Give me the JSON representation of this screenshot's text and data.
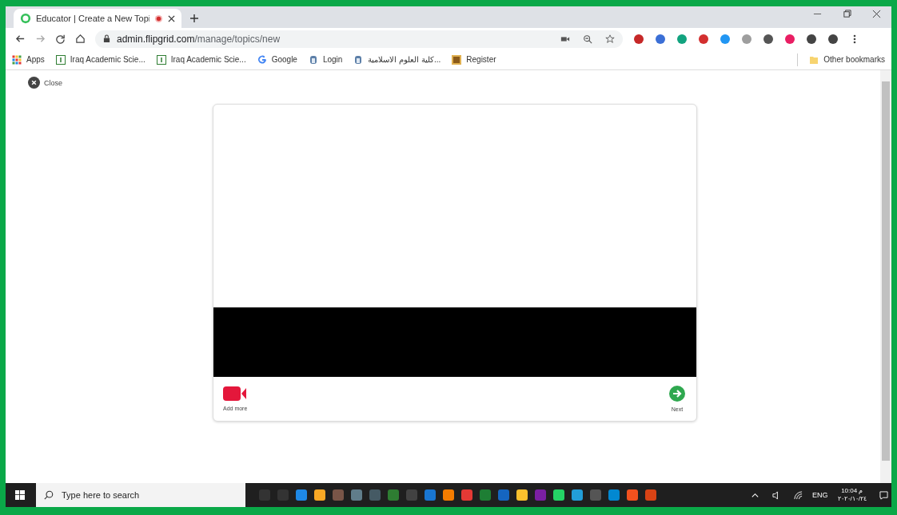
{
  "browser": {
    "tab_title": "Educator | Create a New Topi",
    "url_domain": "admin.flipgrid.com",
    "url_path": "/manage/topics/new",
    "bookmarks": [
      {
        "label": "Apps",
        "kind": "apps"
      },
      {
        "label": "Iraq Academic Scie...",
        "kind": "journal"
      },
      {
        "label": "Iraq Academic Scie...",
        "kind": "journal"
      },
      {
        "label": "Google",
        "kind": "google"
      },
      {
        "label": "Login",
        "kind": "emblem"
      },
      {
        "label": "كلية العلوم الاسلامية...",
        "kind": "emblem"
      },
      {
        "label": "Register",
        "kind": "register"
      }
    ],
    "other_bookmarks": "Other bookmarks"
  },
  "page": {
    "close": "Close"
  },
  "modal": {
    "add_more": "Add more",
    "next": "Next"
  },
  "taskbar": {
    "search_placeholder": "Type here to search",
    "language": "ENG",
    "time": "10:04 م",
    "date": "٢٠٢٠/١٠/٢٤"
  }
}
